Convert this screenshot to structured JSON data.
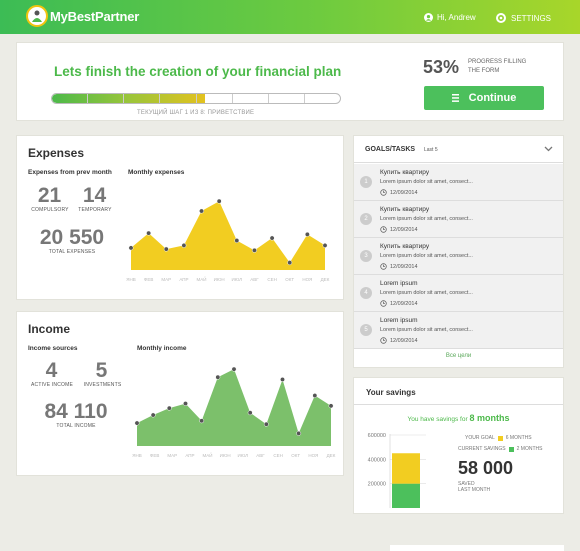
{
  "app": {
    "name": "MyBestPartner"
  },
  "header": {
    "user_label": "Hi, Andrew",
    "settings_label": "SETTINGS"
  },
  "plan": {
    "title": "Lets finish the creation of your financial plan",
    "step_text": "ТЕКУЩИЙ ШАГ 1 ИЗ 8: ПРИВЕТСТВИЕ",
    "progress_percent": "53%",
    "progress_value": 0.53,
    "progress_label": "PROGRESS FILLING THE FORM",
    "continue_label": "Continue"
  },
  "expenses": {
    "title": "Expenses",
    "prev_month_label": "Expenses from prev month",
    "compulsory": "21",
    "compulsory_label": "COMPULSORY",
    "temporary": "14",
    "temporary_label": "TEMPORARY",
    "total": "20 550",
    "total_label": "TOTAL EXPENSES",
    "chart_label": "Monthly expenses"
  },
  "income": {
    "title": "Income",
    "sources_label": "Income sources",
    "active": "4",
    "active_label": "ACTIVE INCOME",
    "investments": "5",
    "investments_label": "INVESTMENTS",
    "total": "84 110",
    "total_label": "TOTAL INCOME",
    "chart_label": "Monthly income"
  },
  "goals": {
    "title": "GOALS/TASKS",
    "subtitle": "Last 5",
    "items": [
      {
        "num": "1",
        "title": "Купить квартиру",
        "desc": "Lorem ipsum dolor sit amet, consect...",
        "date": "12/09/2014"
      },
      {
        "num": "2",
        "title": "Купить квартиру",
        "desc": "Lorem ipsum dolor sit amet, consect...",
        "date": "12/09/2014"
      },
      {
        "num": "3",
        "title": "Купить квартиру",
        "desc": "Lorem ipsum dolor sit amet, consect...",
        "date": "12/09/2014"
      },
      {
        "num": "4",
        "title": "Lorem ipsum",
        "desc": "Lorem ipsum dolor sit amet, consect...",
        "date": "12/09/2014"
      },
      {
        "num": "5",
        "title": "Lorem ipsum",
        "desc": "Lorem ipsum dolor sit amet, consect...",
        "date": "12/09/2014"
      }
    ],
    "all_link": "Все цели"
  },
  "savings": {
    "title": "Your savings",
    "note_prefix": "You have savings for",
    "note_months": "8 months",
    "goal_label": "YOUR GOAL",
    "goal_value": "6 MONTHS",
    "current_label": "CURRENT SAVINGS",
    "current_value": "2 MONTHS",
    "amount": "58 000",
    "saved_label_1": "SAVED",
    "saved_label_2": "LAST MONTH",
    "colors": {
      "goal": "#f2cd21",
      "current": "#4cc05c"
    }
  },
  "chart_data": [
    {
      "type": "area",
      "title": "Monthly expenses",
      "categories": [
        "ЯНВ",
        "ФЕВ",
        "МАР",
        "АПР",
        "МАЙ",
        "ИЮН",
        "ИЮЛ",
        "АВГ",
        "СЕН",
        "ОКТ",
        "НОЯ",
        "ДЕК"
      ],
      "values": [
        18,
        30,
        17,
        20,
        48,
        56,
        24,
        16,
        26,
        6,
        29,
        20
      ],
      "ylim": [
        0,
        70
      ],
      "color": "#f2cd21"
    },
    {
      "type": "area",
      "title": "Monthly income",
      "categories": [
        "ЯНВ",
        "ФЕВ",
        "МАР",
        "АПР",
        "МАЙ",
        "ИЮН",
        "ИЮЛ",
        "АВГ",
        "СЕН",
        "ОКТ",
        "НОЯ",
        "ДЕК"
      ],
      "values": [
        20,
        27,
        33,
        37,
        22,
        60,
        67,
        29,
        19,
        58,
        11,
        44,
        35
      ],
      "ylim": [
        0,
        75
      ],
      "color": "#7cc06b"
    },
    {
      "type": "bar",
      "title": "Your savings",
      "categories": [
        "savings"
      ],
      "series": [
        {
          "name": "CURRENT SAVINGS",
          "values": [
            200000
          ]
        },
        {
          "name": "YOUR GOAL",
          "values": [
            250000
          ]
        }
      ],
      "ylim": [
        0,
        600000
      ],
      "yticks": [
        "600000",
        "400000",
        "200000"
      ]
    }
  ]
}
